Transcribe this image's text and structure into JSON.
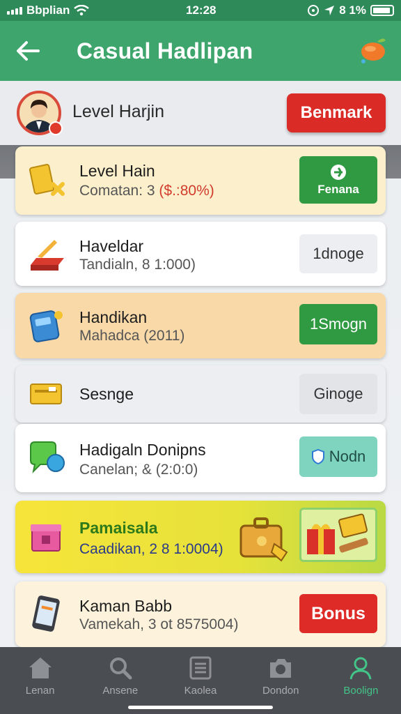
{
  "status_bar": {
    "carrier": "Bbplian",
    "time": "12:28",
    "battery_text": "8 1%"
  },
  "header": {
    "title": "Casual Hadlipan"
  },
  "profile": {
    "name": "Level Harjin",
    "action_label": "Benmark"
  },
  "cards": [
    {
      "title": "Level Hain",
      "subtitle_prefix": "Comatan: 3",
      "subtitle_highlight": "($.:80%)",
      "button_label": "Fenana"
    },
    {
      "title": "Haveldar",
      "subtitle": "Tandialn, 8 1:000)",
      "button_label": "1dnoge"
    },
    {
      "title": "Handikan",
      "subtitle": "Mahadca (2011)",
      "button_label": "1Smogn"
    },
    {
      "title": "Sesnge",
      "button_label": "Ginoge"
    },
    {
      "title": "Hadigaln Donipns",
      "subtitle": "Canelan; & (2:0:0)",
      "button_label": "Nodn"
    },
    {
      "title": "Pamaisala",
      "subtitle": "Caadikan, 2 8 1:0004)"
    },
    {
      "title": "Kaman Babb",
      "subtitle": "Vamekah, 3 ot 8575004)",
      "button_label": "Bonus"
    }
  ],
  "nav": [
    {
      "label": "Lenan",
      "icon": "home-icon"
    },
    {
      "label": "Ansene",
      "icon": "search-icon"
    },
    {
      "label": "Kaolea",
      "icon": "list-icon"
    },
    {
      "label": "Dondon",
      "icon": "camera-icon"
    },
    {
      "label": "Boolign",
      "icon": "person-icon",
      "active": true
    }
  ],
  "colors": {
    "primary": "#3ea56c",
    "accent_red": "#db2b27",
    "active_nav": "#43c488"
  }
}
